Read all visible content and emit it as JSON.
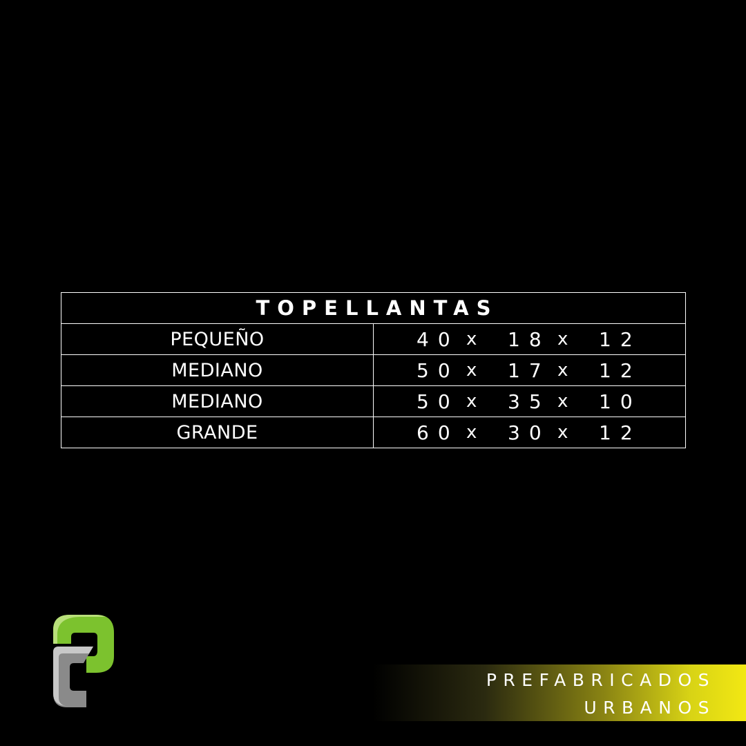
{
  "table": {
    "title": "TOPELLANTAS",
    "rows": [
      {
        "name": "PEQUEÑO",
        "dims": [
          "40",
          "18",
          "12"
        ]
      },
      {
        "name": "MEDIANO",
        "dims": [
          "50",
          "17",
          "12"
        ]
      },
      {
        "name": "MEDIANO",
        "dims": [
          "50",
          "35",
          "10"
        ]
      },
      {
        "name": "GRANDE",
        "dims": [
          "60",
          "30",
          "12"
        ]
      }
    ],
    "separator": "x"
  },
  "brand": {
    "line1": "PREFABRICADOS",
    "line2": "URBANOS",
    "logo_icon": "pu-logo-icon",
    "colors": {
      "green_dark": "#7cc22e",
      "green_light": "#b9e07a",
      "gray_dark": "#8a8a8a",
      "gray_light": "#c8c8c8",
      "banner_yellow": "#f2e813"
    }
  }
}
